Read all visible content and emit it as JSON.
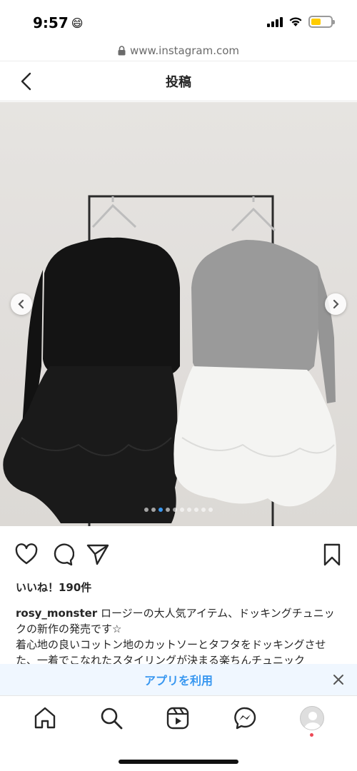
{
  "status_bar": {
    "time": "9:57",
    "time_emoji": "😄",
    "battery_level": 0.5,
    "battery_color": "#ffcc00"
  },
  "browser": {
    "url": "www.instagram.com"
  },
  "header": {
    "title": "投稿"
  },
  "carousel": {
    "dot_count": 10,
    "active_index": 2,
    "accent_color": "#3897f0"
  },
  "actions": {
    "like": "heart-icon",
    "comment": "comment-icon",
    "share": "paper-plane-icon",
    "save": "bookmark-icon"
  },
  "post": {
    "likes": "いいね！190件",
    "username": "rosy_monster",
    "caption_line1": " ロージーの大人気アイテム、ドッキングチュニックの新作の発売です☆",
    "caption_line2": "着心地の良いコットン地のカットソーとタフタをドッキングさせた、一着でこなれたスタイリングが決まる楽ちんチュニック"
  },
  "app_banner": {
    "label": "アプリを利用"
  },
  "bottom_nav": {
    "items": [
      "home-icon",
      "search-icon",
      "reels-icon",
      "messenger-icon",
      "profile-icon"
    ]
  }
}
